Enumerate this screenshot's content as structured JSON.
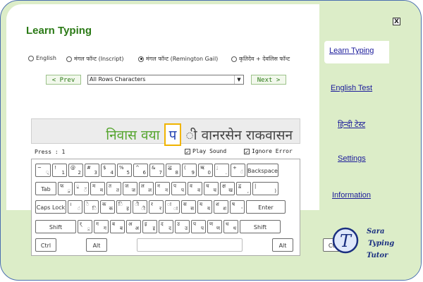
{
  "app": {
    "title": "Learn Typing",
    "close_glyph": "X"
  },
  "modes": [
    {
      "label": "English",
      "selected": false
    },
    {
      "label": "मंगल फॉन्ट (Inscript)",
      "selected": false
    },
    {
      "label": "मंगल फॉन्ट (Remington Gail)",
      "selected": true
    },
    {
      "label": "कृतिदेव + देवलिस फॉन्ट",
      "selected": false
    }
  ],
  "nav": {
    "prev_label": "< Prev",
    "next_label": "Next >",
    "lesson_value": "All Rows Characters"
  },
  "practice": {
    "typed": "निवास वया",
    "current": "प",
    "remaining": "ी वानरसेन राकवासन"
  },
  "status": {
    "press_text": "Press : 1",
    "play_sound": "Play Sound",
    "ignore_error": "Ignore Error"
  },
  "keyboard": {
    "row1": [
      {
        "k1": "~",
        "k2": "्"
      },
      {
        "k1": "!",
        "k2": "1"
      },
      {
        "k1": "@",
        "k2": "2"
      },
      {
        "k1": "#",
        "k2": "3"
      },
      {
        "k1": "$",
        "k2": "4"
      },
      {
        "k1": "%",
        "k2": "5"
      },
      {
        "k1": "^",
        "k2": "6"
      },
      {
        "k1": "&",
        "k2": "7"
      },
      {
        "k1": "द्ध",
        "k2": "8"
      },
      {
        "k1": "(",
        "k2": "9"
      },
      {
        "k1": "ऋ",
        "k2": "0"
      },
      {
        "k1": ";",
        "k2": "."
      },
      {
        "k1": "+",
        "k2": "ं"
      },
      {
        "label": "Backspace",
        "special": true
      }
    ],
    "row2": [
      {
        "label": "Tab",
        "special": true
      },
      {
        "k1": "फ",
        "k2": "ु"
      },
      {
        "k1": "ू",
        "k2": "ॅ"
      },
      {
        "k1": "म",
        "k2": "म"
      },
      {
        "k1": "त",
        "k2": "त"
      },
      {
        "k1": "ज",
        "k2": "ज"
      },
      {
        "k1": "ल",
        "k2": "ल"
      },
      {
        "k1": "न",
        "k2": "न"
      },
      {
        "k1": "प",
        "k2": "प"
      },
      {
        "k1": "व",
        "k2": "व"
      },
      {
        "k1": "च",
        "k2": "च"
      },
      {
        "k1": "क्ष",
        "k2": "ख"
      },
      {
        "k1": "द्व",
        "k2": ","
      },
      {
        "k1": "|",
        "k2": ")"
      }
    ],
    "row3": [
      {
        "label": "Caps Lock",
        "special": true
      },
      {
        "k1": "।",
        "k2": "ं"
      },
      {
        "k1": "े",
        "k2": "ि"
      },
      {
        "k1": "क",
        "k2": "क"
      },
      {
        "k1": "ि",
        "k2": "ह"
      },
      {
        "k1": "ी",
        "k2": "ी"
      },
      {
        "k1": "र",
        "k2": "र"
      },
      {
        "k1": "ा",
        "k2": "ा"
      },
      {
        "k1": "स",
        "k2": "स"
      },
      {
        "k1": "य",
        "k2": "य"
      },
      {
        "k1": "श",
        "k2": "श"
      },
      {
        "k1": "ष",
        "k2": "'"
      },
      {
        "label": "Enter",
        "special": true
      }
    ],
    "row4": [
      {
        "label": "Shift",
        "special": true
      },
      {
        "k1": "र्",
        "k2": "्र"
      },
      {
        "k1": "ग",
        "k2": "ग"
      },
      {
        "k1": "ब",
        "k2": "ब"
      },
      {
        "k1": "अ",
        "k2": "अ"
      },
      {
        "k1": "इ",
        "k2": "इ"
      },
      {
        "k1": "द",
        "k2": "द"
      },
      {
        "k1": "उ",
        "k2": "उ"
      },
      {
        "k1": "प",
        "k2": "प"
      },
      {
        "k1": "ण",
        "k2": "ण"
      },
      {
        "k1": "ध",
        "k2": "ध"
      },
      {
        "label": "Shift",
        "special": true
      }
    ],
    "row5": [
      {
        "label": "Ctrl",
        "special": true
      },
      {
        "label": "Alt",
        "special": true
      },
      {
        "label": "",
        "special": true
      },
      {
        "label": "Alt",
        "special": true
      },
      {
        "label": "Ctrl",
        "special": true
      }
    ]
  },
  "sidebar": {
    "items": [
      {
        "label": "Learn Typing",
        "active": true
      },
      {
        "label": "English Test",
        "active": false
      },
      {
        "label": "हिन्दी टेस्ट",
        "active": false
      },
      {
        "label": "Settings",
        "active": false
      },
      {
        "label": "Information",
        "active": false
      }
    ]
  },
  "logo": {
    "initial": "T",
    "line1": "Sara",
    "line2": "Typing",
    "line3": "Tutor"
  },
  "colors": {
    "accent": "#2b7a16",
    "panel": "#dcedc8",
    "link": "#1a1a9a",
    "highlight": "#f0b400"
  }
}
